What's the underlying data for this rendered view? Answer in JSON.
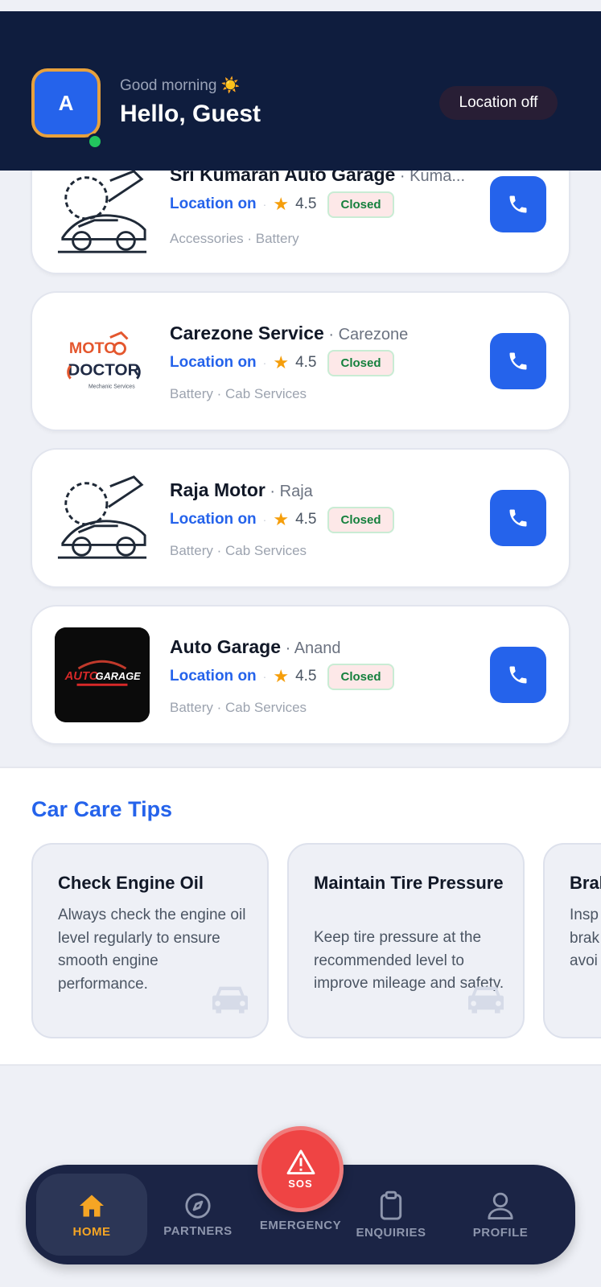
{
  "header": {
    "avatar_letter": "A",
    "greeting": "Good morning ☀️",
    "title": "Hello, Guest",
    "location_status": "Location off"
  },
  "garages": [
    {
      "name": "Sri Kumaran Auto Garage",
      "owner": "Kuma...",
      "location": "Location on",
      "rating": "4.5",
      "status": "Closed",
      "categories": "Accessories · Battery",
      "logo": "mechanic-car-icon"
    },
    {
      "name": "Carezone Service",
      "owner": "Carezone",
      "location": "Location on",
      "rating": "4.5",
      "status": "Closed",
      "categories": "Battery · Cab Services",
      "logo": "moto-doctor-logo",
      "logo_text_top": "MOTO",
      "logo_text_main": "DOCTOR",
      "logo_text_sub": "Mechanic Services"
    },
    {
      "name": "Raja Motor",
      "owner": "Raja",
      "location": "Location on",
      "rating": "4.5",
      "status": "Closed",
      "categories": "Battery · Cab Services",
      "logo": "mechanic-car-icon"
    },
    {
      "name": "Auto Garage",
      "owner": "Anand",
      "location": "Location on",
      "rating": "4.5",
      "status": "Closed",
      "categories": "Battery · Cab Services",
      "logo": "auto-garage-logo",
      "logo_text_a": "AUTO",
      "logo_text_b": "GARAGE"
    }
  ],
  "tips": {
    "title": "Car Care Tips",
    "items": [
      {
        "title": "Check Engine Oil",
        "body": "Always check the engine oil level regularly to ensure smooth engine performance."
      },
      {
        "title": "Maintain Tire Pressure",
        "body": "Keep tire pressure at the recommended level to improve mileage and safety."
      },
      {
        "title": "Bral",
        "body": "Insp brak avoi"
      }
    ]
  },
  "nav": {
    "home": "HOME",
    "partners": "PARTNERS",
    "sos": "SOS",
    "emergency": "EMERGENCY",
    "enquiries": "ENQUIRIES",
    "profile": "PROFILE"
  },
  "colors": {
    "header_bg": "#0f1d3e",
    "accent_blue": "#2563eb",
    "nav_bg": "#1b2445",
    "active_orange": "#f5a524",
    "sos_red": "#ef4444",
    "star": "#f59e0b"
  }
}
